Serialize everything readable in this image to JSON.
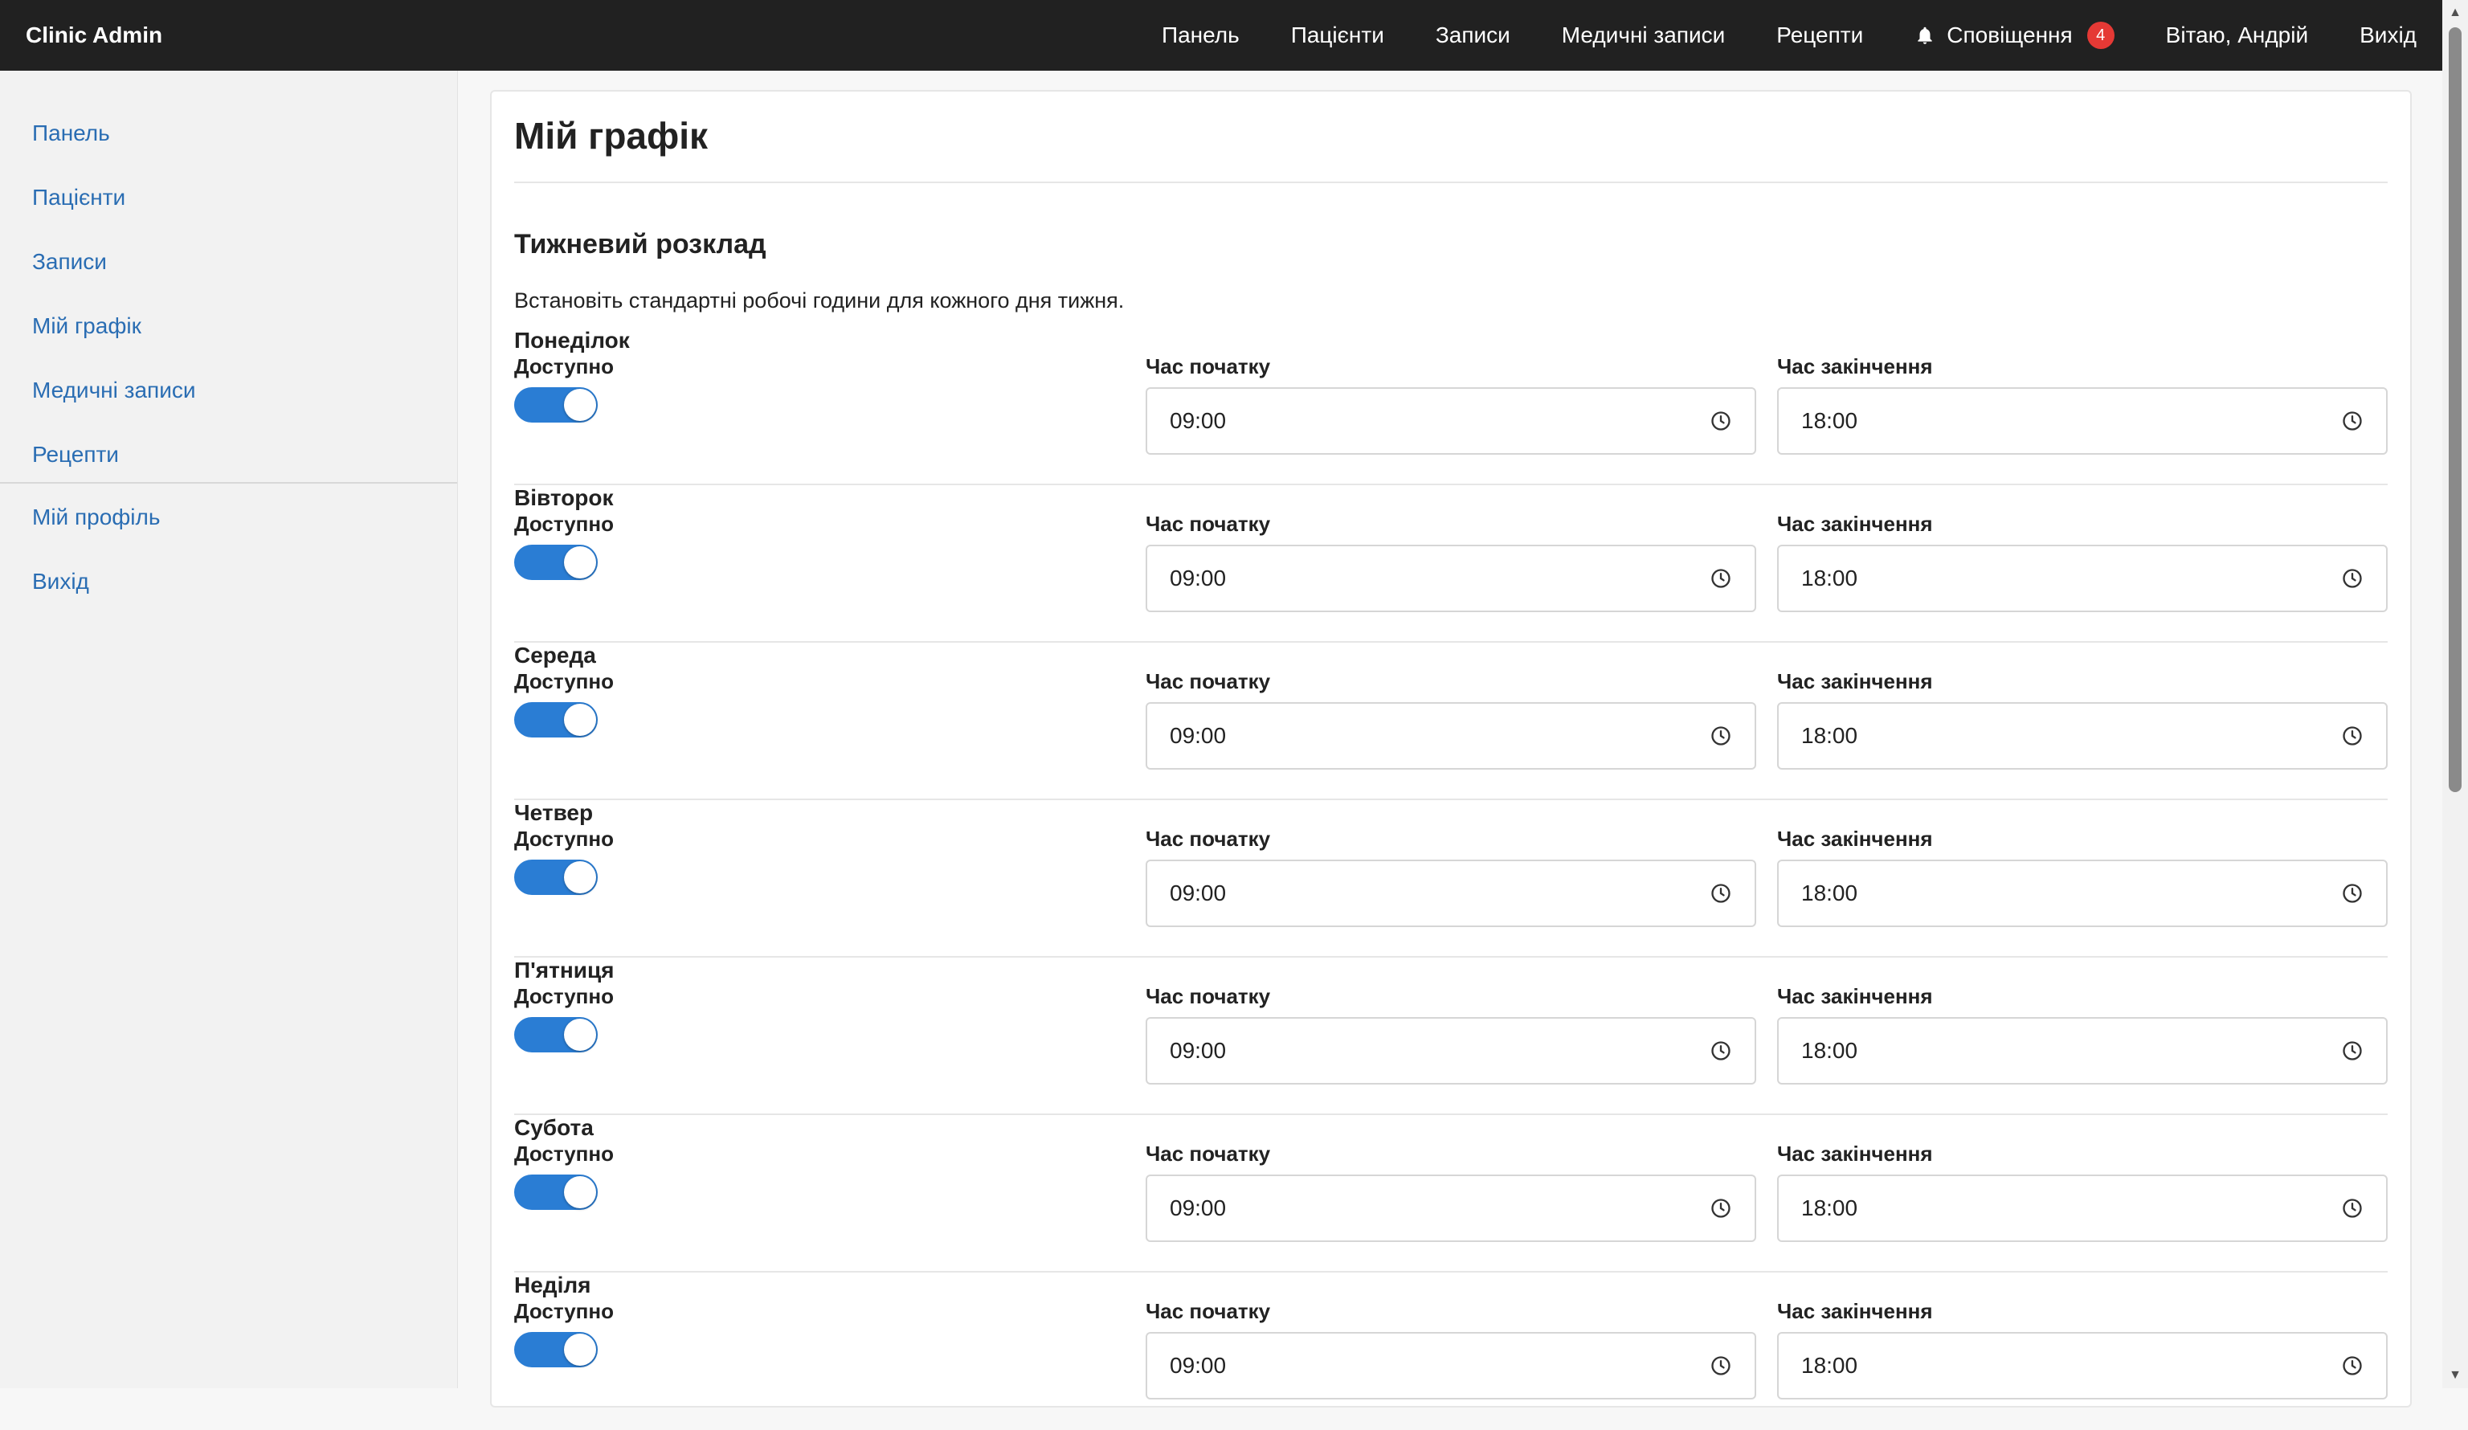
{
  "app": {
    "brand": "Clinic Admin"
  },
  "topnav": {
    "items": [
      {
        "label": "Панель"
      },
      {
        "label": "Пацієнти"
      },
      {
        "label": "Записи"
      },
      {
        "label": "Медичні записи"
      },
      {
        "label": "Рецепти"
      }
    ],
    "notifications": {
      "label": "Сповіщення",
      "count": "4",
      "icon": "bell-icon"
    },
    "greeting": "Вітаю, Андрій",
    "logout": "Вихід"
  },
  "sidebar": {
    "items": [
      {
        "label": "Панель"
      },
      {
        "label": "Пацієнти"
      },
      {
        "label": "Записи"
      },
      {
        "label": "Мій графік"
      },
      {
        "label": "Медичні записи"
      },
      {
        "label": "Рецепти"
      }
    ],
    "bottom_items": [
      {
        "label": "Мій профіль"
      },
      {
        "label": "Вихід"
      }
    ]
  },
  "page": {
    "title": "Мій графік",
    "section_title": "Тижневий розклад",
    "section_desc": "Встановіть стандартні робочі години для кожного дня тижня.",
    "available_label": "Доступно",
    "start_label": "Час початку",
    "end_label": "Час закінчення",
    "days": [
      {
        "name": "Понеділок",
        "available": true,
        "start": "09:00",
        "end": "18:00"
      },
      {
        "name": "Вівторок",
        "available": true,
        "start": "09:00",
        "end": "18:00"
      },
      {
        "name": "Середа",
        "available": true,
        "start": "09:00",
        "end": "18:00"
      },
      {
        "name": "Четвер",
        "available": true,
        "start": "09:00",
        "end": "18:00"
      },
      {
        "name": "П'ятниця",
        "available": true,
        "start": "09:00",
        "end": "18:00"
      },
      {
        "name": "Субота",
        "available": true,
        "start": "09:00",
        "end": "18:00"
      },
      {
        "name": "Неділя",
        "available": true,
        "start": "09:00",
        "end": "18:00"
      }
    ]
  },
  "colors": {
    "navbar": "#212121",
    "link": "#2a6db3",
    "toggle_on": "#2a7dd4",
    "badge": "#e53935"
  }
}
